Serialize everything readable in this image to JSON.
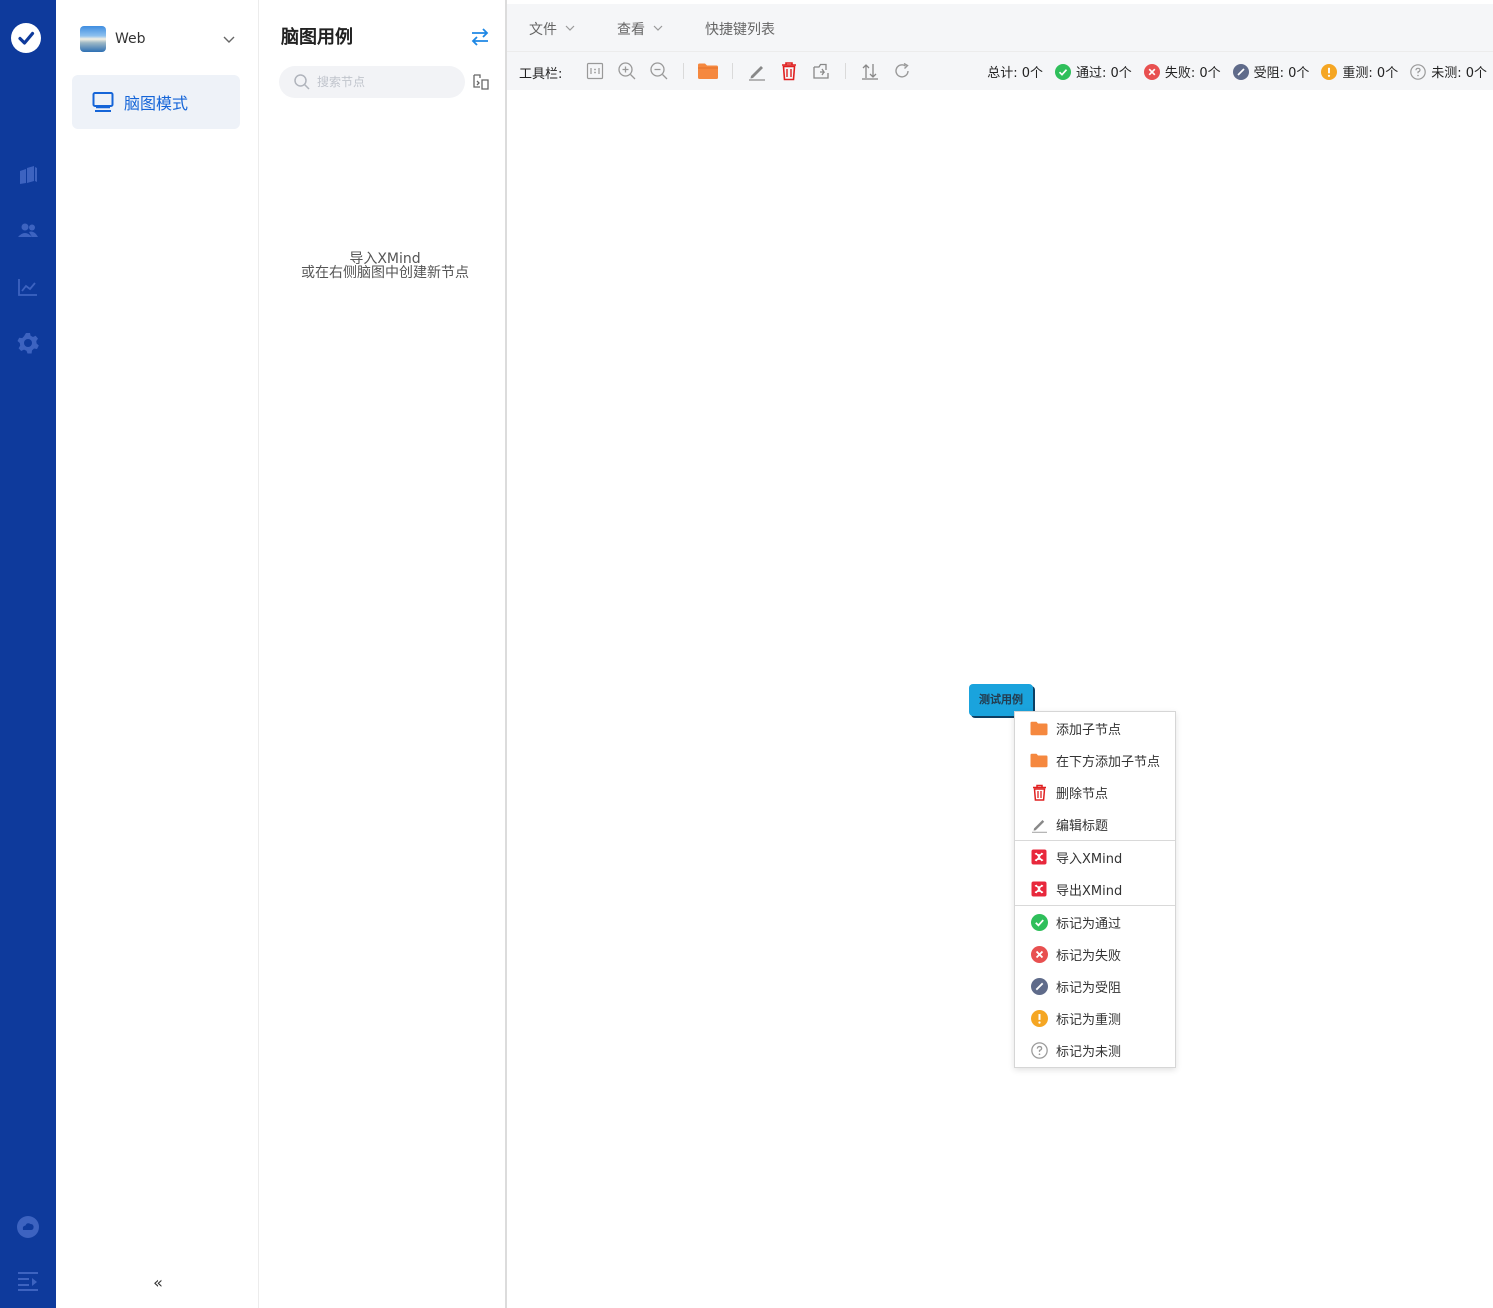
{
  "project": {
    "name": "Web"
  },
  "nav": {
    "mode_label": "脑图模式",
    "collapse_glyph": "«"
  },
  "rail_icons": [
    "logo-check-icon",
    "books-icon",
    "users-icon",
    "chart-icon",
    "gear-icon",
    "cloud-icon",
    "menu-fold-icon"
  ],
  "panel": {
    "title": "脑图用例",
    "search_placeholder": "搜索节点",
    "empty_line1": "导入XMind",
    "empty_line2": "或在右侧脑图中创建新节点"
  },
  "menubar": {
    "file": "文件",
    "view": "查看",
    "shortcuts": "快捷键列表"
  },
  "toolbar": {
    "label": "工具栏:",
    "buttons": [
      "actual-size",
      "zoom-in",
      "zoom-out",
      "add-child",
      "edit",
      "delete",
      "move",
      "collapse-expand",
      "refresh"
    ]
  },
  "stats": {
    "total": "总计: 0个",
    "pass": "通过: 0个",
    "fail": "失败: 0个",
    "blocked": "受阻: 0个",
    "retest": "重测: 0个",
    "untested": "未测: 0个"
  },
  "mindmap": {
    "root_label": "测试用例"
  },
  "context_menu": {
    "add_child": "添加子节点",
    "add_child_below": "在下方添加子节点",
    "delete_node": "删除节点",
    "edit_title": "编辑标题",
    "import_xmind": "导入XMind",
    "export_xmind": "导出XMind",
    "mark_pass": "标记为通过",
    "mark_fail": "标记为失败",
    "mark_blocked": "标记为受阻",
    "mark_retest": "标记为重测",
    "mark_untested": "标记为未测"
  },
  "colors": {
    "rail": "#0e3a9c",
    "accent": "#1565d8",
    "root_node": "#1aa3dd",
    "pass": "#2fbf5b",
    "fail": "#e85050",
    "blocked": "#5f6b8a",
    "retest": "#f5a623",
    "untested": "#9a9a9a",
    "folder": "#f5883f",
    "delete": "#e02020",
    "xmind": "#e8283c"
  }
}
